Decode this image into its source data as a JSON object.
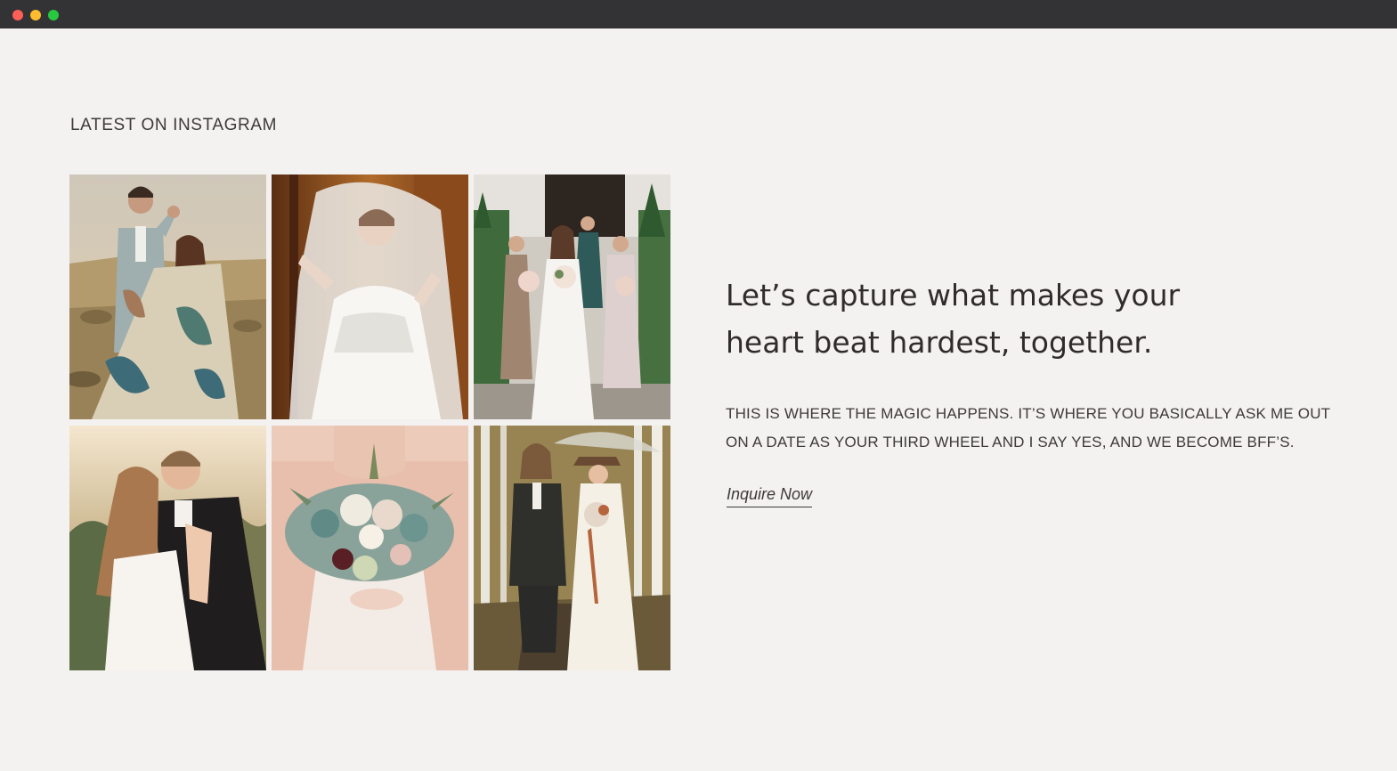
{
  "window": {
    "controls": [
      {
        "name": "close",
        "color": "#fe5f57"
      },
      {
        "name": "minimize",
        "color": "#febc2e"
      },
      {
        "name": "zoom",
        "color": "#28c840"
      }
    ]
  },
  "instagram": {
    "title": "LATEST ON INSTAGRAM",
    "photos": [
      {
        "subject": "couple-in-desert"
      },
      {
        "subject": "bride-with-veil"
      },
      {
        "subject": "bride-with-bridesmaids"
      },
      {
        "subject": "couple-kissing"
      },
      {
        "subject": "bride-bouquet"
      },
      {
        "subject": "couple-in-aspen-forest"
      }
    ]
  },
  "cta": {
    "headline": "Let’s capture what makes your heart beat hardest, together.",
    "body": "THIS IS WHERE THE MAGIC HAPPENS. IT’S WHERE YOU BASICALLY ASK ME OUT ON A DATE AS YOUR THIRD WHEEL AND I SAY YES, AND WE BECOME BFF’S.",
    "link_label": "Inquire Now"
  },
  "colors": {
    "background": "#f4f2f1",
    "titlebar": "#333335",
    "text": "#3d3a39"
  }
}
